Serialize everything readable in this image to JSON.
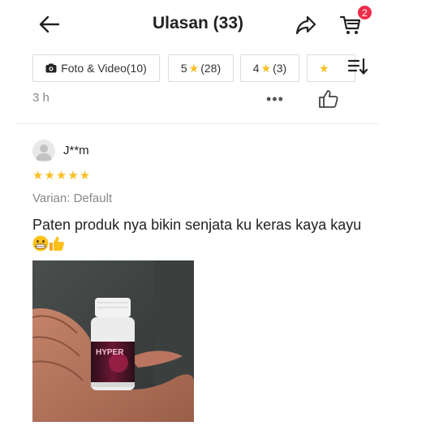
{
  "header": {
    "title": "Ulasan (33)",
    "cart_badge": "2"
  },
  "filters": [
    {
      "label": "Foto & Video(10)"
    },
    {
      "label": "5",
      "count": "(28)"
    },
    {
      "label": "4",
      "count": "(3)"
    },
    {
      "label": ""
    }
  ],
  "meta": {
    "time": "3 h",
    "more": "•••"
  },
  "review": {
    "username": "J**m",
    "stars": "★★★★★",
    "variant": "Varian: Default",
    "text": "Paten produk nya bikin senjata ku keras kaya kayu",
    "product_label": "HYPER"
  },
  "colors": {
    "star": "#fbbf24",
    "badge": "#ee2d4a",
    "text": "#222222",
    "muted": "#888888"
  }
}
